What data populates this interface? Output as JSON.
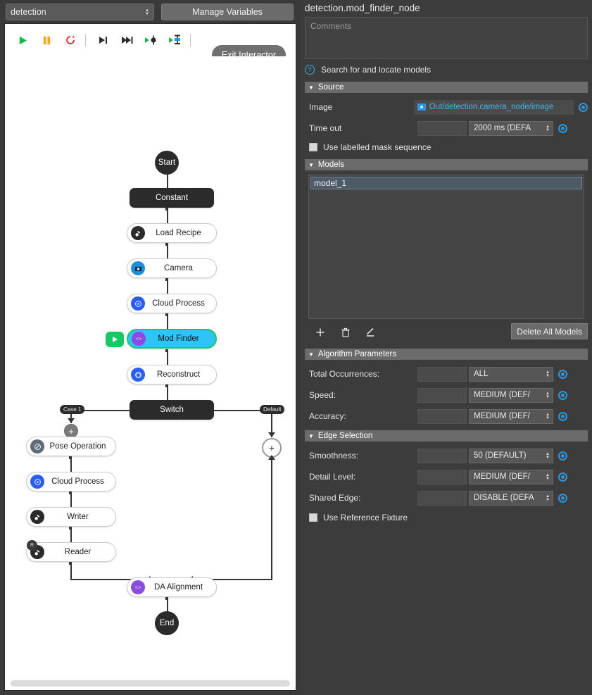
{
  "toolbar_top": {
    "graph_select_value": "detection",
    "manage_variables_label": "Manage Variables"
  },
  "canvas_toolbar": {
    "buttons": [
      {
        "name": "run-icon",
        "glyph": "▶",
        "color": "#17b84a"
      },
      {
        "name": "pause-icon",
        "glyph": "▐▌",
        "color": "#f5a623"
      },
      {
        "name": "reset-icon",
        "glyph": "↻",
        "color": "#e02020"
      },
      {
        "name": "step-into-icon",
        "glyph": "▶|",
        "color": "#2b2b2b"
      },
      {
        "name": "step-over-icon",
        "glyph": "▶▶|",
        "color": "#2b2b2b"
      },
      {
        "name": "run-to-node-icon",
        "glyph": "▸⬢",
        "color": "#2b2b2b"
      },
      {
        "name": "run-from-node-icon",
        "glyph": "▸⯀",
        "color": "#2b2b2b"
      }
    ],
    "exit_interactor_label": "Exit Interactor"
  },
  "flow": {
    "start_label": "Start",
    "end_label": "End",
    "nodes": [
      {
        "label": "Constant",
        "icon": "none",
        "style": "dark"
      },
      {
        "label": "Load Recipe",
        "icon": "recipe-icon",
        "style": "plain",
        "icon_color": "#2b2b2b"
      },
      {
        "label": "Camera",
        "icon": "camera-icon",
        "style": "plain",
        "icon_color": "#1f8fd6"
      },
      {
        "label": "Cloud Process",
        "icon": "cloud-icon",
        "style": "plain",
        "icon_color": "#2b5ef0"
      },
      {
        "label": "Mod Finder",
        "icon": "code-icon",
        "style": "selected",
        "icon_color": "#8b4ce0"
      },
      {
        "label": "Reconstruct",
        "icon": "cube-icon",
        "style": "plain",
        "icon_color": "#2b5ef0"
      },
      {
        "label": "Switch",
        "icon": "none",
        "style": "dark"
      },
      {
        "label": "Pose Operation",
        "icon": "pose-icon",
        "style": "plain",
        "icon_color": "#5f6b75"
      },
      {
        "label": "Cloud Process",
        "icon": "cloud-icon",
        "style": "plain",
        "icon_color": "#2b5ef0"
      },
      {
        "label": "Writer",
        "icon": "writer-icon",
        "style": "plain",
        "icon_color": "#2b2b2b"
      },
      {
        "label": "Reader",
        "icon": "reader-icon",
        "style": "plain",
        "icon_color": "#2b2b2b"
      },
      {
        "label": "DA Alignment",
        "icon": "code-icon",
        "style": "plain",
        "icon_color": "#8b4ce0"
      }
    ],
    "branch_case_label": "Case 1",
    "branch_default_label": "Default",
    "add_plus_label": "+",
    "play_badge": "play-node-icon"
  },
  "inspector": {
    "node_title": "detection.mod_finder_node",
    "comments_placeholder": "Comments",
    "help_text": "Search for and locate models",
    "sections": {
      "source": {
        "title": "Source",
        "image_label": "Image",
        "image_value": "Out/detection.camera_node/image",
        "timeout_label": "Time out",
        "timeout_value": "2000 ms (DEFA",
        "timeout_text": "",
        "masked_checkbox_label": "Use labelled mask sequence"
      },
      "models": {
        "title": "Models",
        "items": [
          "model_1"
        ],
        "add_label": "+",
        "delete_icon": "trash-icon",
        "edit_icon": "pencil-icon",
        "delete_all_label": "Delete All Models"
      },
      "algorithm": {
        "title": "Algorithm Parameters",
        "rows": [
          {
            "label": "Total Occurrences:",
            "text": "",
            "value": "ALL"
          },
          {
            "label": "Speed:",
            "text": "",
            "value": "MEDIUM (DEF/"
          },
          {
            "label": "Accuracy:",
            "text": "",
            "value": "MEDIUM (DEF/"
          }
        ]
      },
      "edge": {
        "title": "Edge Selection",
        "rows": [
          {
            "label": "Smoothness:",
            "text": "",
            "value": "50 (DEFAULT)"
          },
          {
            "label": "Detail Level:",
            "text": "",
            "value": "MEDIUM (DEF/"
          },
          {
            "label": "Shared Edge:",
            "text": "",
            "value": "DISABLE (DEFA"
          }
        ],
        "reference_checkbox_label": "Use Reference Fixture"
      }
    }
  },
  "colors": {
    "accent_blue": "#2f96dd",
    "link_blue": "#3fb6ea",
    "selected_node": "#2ec4f5",
    "selected_border": "#17c964",
    "annotation_red": "#e01b1b",
    "panel_bg": "#3c3c3c",
    "section_header": "#6b6b6b"
  }
}
